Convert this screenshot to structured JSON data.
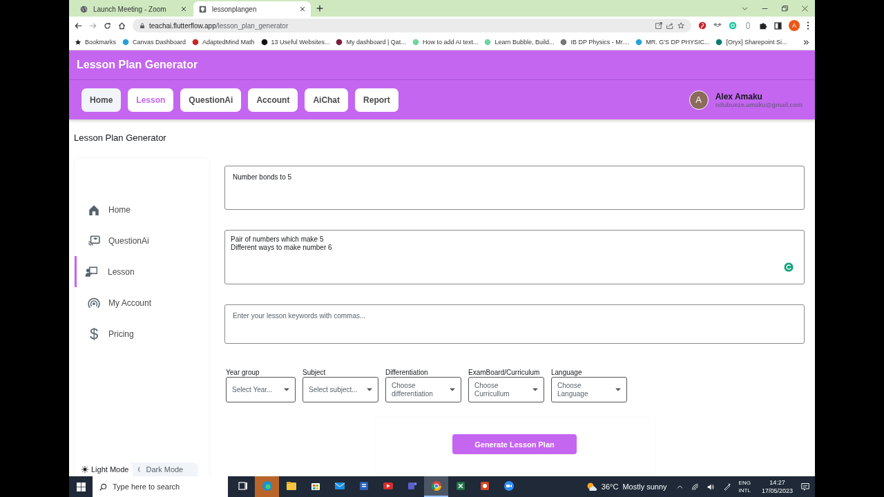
{
  "browser": {
    "tabs": [
      {
        "title": "Launch Meeting - Zoom",
        "selected": false
      },
      {
        "title": "lessonplangen",
        "selected": true
      }
    ],
    "url_host": "teachai.flutterflow.app",
    "url_path": "/lesson_plan_generator",
    "profile_initial": "A",
    "bookmarks": [
      "Bookmarks",
      "Canvas Dashboard",
      "AdaptedMind Math",
      "13 Useful Websites...",
      "My dashboard | Qat...",
      "How to add AI text...",
      "Learn Bubble, Build...",
      "IB DP Physics - Mr....",
      "MR. G'S DP PHYSIC...",
      "[Oryx] Sharepoint Si..."
    ]
  },
  "app": {
    "title": "Lesson Plan Generator",
    "nav": [
      {
        "label": "Home",
        "selected": false,
        "hovered": true
      },
      {
        "label": "Lesson",
        "selected": true,
        "hovered": false
      },
      {
        "label": "QuestionAi",
        "selected": false,
        "hovered": false
      },
      {
        "label": "Account",
        "selected": false,
        "hovered": false
      },
      {
        "label": "AiChat",
        "selected": false,
        "hovered": false
      },
      {
        "label": "Report",
        "selected": false,
        "hovered": false
      }
    ],
    "user": {
      "initial": "A",
      "name": "Alex Amaku",
      "email": "ndubueze.amaku@gmail.com"
    }
  },
  "page_title": "Lesson Plan Generator",
  "sidebar": {
    "items": [
      {
        "kind": "home",
        "label": "Home",
        "selected": false
      },
      {
        "kind": "question",
        "label": "QuestionAi",
        "selected": false
      },
      {
        "kind": "lesson",
        "label": "Lesson",
        "selected": true
      },
      {
        "kind": "account",
        "label": "My Account",
        "selected": false
      },
      {
        "kind": "pricing",
        "glyph": "$",
        "label": "Pricing",
        "selected": false
      }
    ],
    "modes": [
      {
        "kind": "light",
        "label": "Light Mode",
        "selected": true
      },
      {
        "kind": "dark",
        "label": "Dark Mode",
        "selected": false
      }
    ]
  },
  "form": {
    "topic": {
      "value": "Number bonds to 5"
    },
    "objectives": {
      "value": "Pair of numbers which make 5\nDifferent ways to make number 6"
    },
    "keywords": {
      "placeholder": "Enter your lesson keywords with commas..."
    },
    "dropdowns": [
      {
        "label": "Year group",
        "placeholder": "Select Year..."
      },
      {
        "label": "Subject",
        "placeholder": "Select subject..."
      },
      {
        "label": "Differentiation",
        "placeholder": "Choose differentiation"
      },
      {
        "label": "ExamBoard/Curriculum",
        "placeholder": "Choose Curricullum"
      },
      {
        "label": "Language",
        "placeholder": "Choose Language"
      }
    ],
    "generate_button": "Generate Lesson Plan"
  },
  "taskbar": {
    "search_placeholder": "Type here to search",
    "apps": [
      {
        "kind": "taskview",
        "selected": false,
        "hovered": false
      },
      {
        "kind": "edge",
        "selected": false,
        "hovered": true
      },
      {
        "kind": "folder",
        "selected": false,
        "hovered": false
      },
      {
        "kind": "store",
        "selected": false,
        "hovered": false
      },
      {
        "kind": "mail",
        "selected": false,
        "hovered": false
      },
      {
        "kind": "word",
        "selected": false,
        "hovered": false
      },
      {
        "kind": "video",
        "selected": false,
        "hovered": false
      },
      {
        "kind": "teams",
        "selected": false,
        "hovered": false
      },
      {
        "kind": "chrome",
        "selected": true,
        "hovered": false
      },
      {
        "kind": "excel",
        "selected": false,
        "hovered": false
      },
      {
        "kind": "powerpoint",
        "selected": false,
        "hovered": false
      },
      {
        "kind": "zoom",
        "selected": false,
        "hovered": false
      }
    ],
    "temperature": "36°C",
    "weather": "Mostly sunny",
    "lang": "ENG",
    "layout": "INTL",
    "time": "14:27",
    "date": "17/05/2023"
  }
}
